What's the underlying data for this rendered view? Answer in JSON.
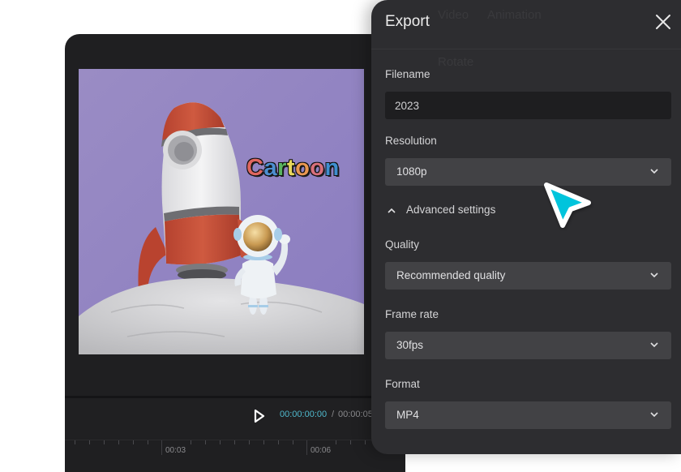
{
  "preview": {
    "overlay_text_letters": [
      {
        "ch": "C",
        "color": "#e0665f"
      },
      {
        "ch": "a",
        "color": "#4d8fd0"
      },
      {
        "ch": "r",
        "color": "#59b45f"
      },
      {
        "ch": "t",
        "color": "#e8d85b"
      },
      {
        "ch": "o",
        "color": "#e99852"
      },
      {
        "ch": "o",
        "color": "#d8707b"
      },
      {
        "ch": "n",
        "color": "#3f8fcf"
      }
    ],
    "overlay_text": "Cartoon"
  },
  "player": {
    "current_time": "00:00:00:00",
    "separator": "/",
    "total_time": "00:00:05",
    "current_time_color": "#4fb8cc"
  },
  "timeline": {
    "labels": [
      "00:03",
      "00:06"
    ]
  },
  "background_tabs": [
    "Video",
    "Animation"
  ],
  "background_row": "Rotate",
  "export": {
    "title": "Export",
    "close_icon": "close-icon",
    "filename": {
      "label": "Filename",
      "value": "2023"
    },
    "resolution": {
      "label": "Resolution",
      "value": "1080p"
    },
    "advanced": {
      "label": "Advanced settings",
      "expanded": true
    },
    "quality": {
      "label": "Quality",
      "value": "Recommended quality"
    },
    "frame_rate": {
      "label": "Frame rate",
      "value": "30fps"
    },
    "format": {
      "label": "Format",
      "value": "MP4"
    }
  },
  "cursor": {
    "icon": "pointer-cursor-icon",
    "color": "#00c4dc"
  }
}
